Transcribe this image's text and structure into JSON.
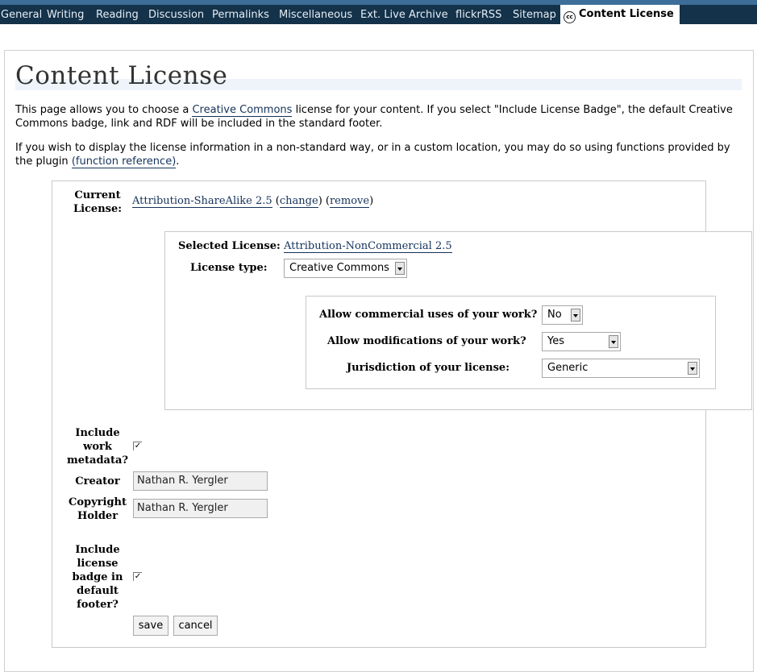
{
  "nav": {
    "tabs": [
      {
        "label": "General"
      },
      {
        "label": "Writing"
      },
      {
        "label": "Reading"
      },
      {
        "label": "Discussion"
      },
      {
        "label": "Permalinks"
      },
      {
        "label": "Miscellaneous"
      },
      {
        "label": "Ext. Live Archive"
      },
      {
        "label": "flickrRSS"
      },
      {
        "label": "Sitemap"
      },
      {
        "label": "Content License",
        "icon": "cc-icon"
      }
    ],
    "cc_icon_text": "cc",
    "active_tab": "Content License"
  },
  "page": {
    "title": "Content License",
    "intro": {
      "before": "This page allows you to choose a ",
      "link": "Creative Commons",
      "after": " license for your content. If you select \"Include License Badge\", the default Creative Commons badge, link and RDF will be included in the standard footer."
    },
    "second": {
      "before": "If you wish to display the license information in a non-standard way, or in a custom location, you may do so using functions provided by the plugin ",
      "link": "(function reference)",
      "after": "."
    }
  },
  "current_license": {
    "label": "Current License:",
    "name": "Attribution-ShareAlike 2.5",
    "change_link": "change",
    "remove_link": "remove"
  },
  "selector": {
    "selected_label": "Selected License:",
    "selected_value": "Attribution-NonCommercial 2.5",
    "type_label": "License type:",
    "type_value": "Creative Commons",
    "commercial_label": "Allow commercial uses of your work?",
    "commercial_value": "No",
    "modifications_label": "Allow modifications of your work?",
    "modifications_value": "Yes",
    "jurisdiction_label": "Jurisdiction of your license:",
    "jurisdiction_value": "Generic"
  },
  "metadata": {
    "include_label": "Include work metadata?",
    "include_checked": true,
    "creator_label": "Creator",
    "creator_value": "Nathan R. Yergler",
    "holder_label": "Copyright Holder",
    "holder_value": "Nathan R. Yergler",
    "badge_label": "Include license badge in default footer?",
    "badge_checked": true
  },
  "actions": {
    "save_label": "save",
    "cancel_label": "cancel"
  }
}
